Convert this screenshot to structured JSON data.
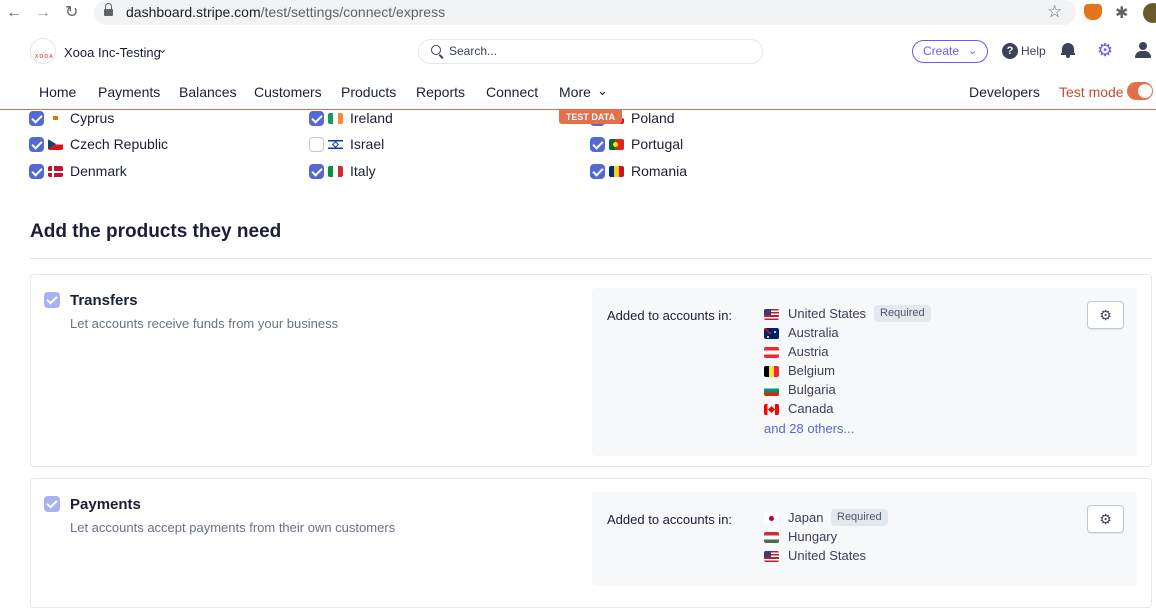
{
  "browser": {
    "url_domain": "dashboard.stripe.com",
    "url_path": "/test/settings/connect/express"
  },
  "header": {
    "account_logo_text": "XOOA",
    "account_name": "Xooa Inc-Testing",
    "search_placeholder": "Search...",
    "create_label": "Create",
    "help_label": "Help"
  },
  "nav": {
    "items": [
      "Home",
      "Payments",
      "Balances",
      "Customers",
      "Products",
      "Reports",
      "Connect",
      "More"
    ],
    "developers": "Developers",
    "test_mode": "Test mode",
    "test_mode_on": true,
    "test_data_badge": "TEST DATA",
    "accent_color": "#e56f4a"
  },
  "countries": [
    {
      "name": "Cyprus",
      "checked": true
    },
    {
      "name": "Czech Republic",
      "checked": true
    },
    {
      "name": "Denmark",
      "checked": true
    },
    {
      "name": "Ireland",
      "checked": true
    },
    {
      "name": "Israel",
      "checked": false
    },
    {
      "name": "Italy",
      "checked": true
    },
    {
      "name": "Poland",
      "checked": true
    },
    {
      "name": "Portugal",
      "checked": true
    },
    {
      "name": "Romania",
      "checked": true
    }
  ],
  "section_title": "Add the products they need",
  "products": [
    {
      "title": "Transfers",
      "description": "Let accounts receive funds from your business",
      "checked": true,
      "added_label": "Added to accounts in:",
      "countries": [
        "United States",
        "Australia",
        "Austria",
        "Belgium",
        "Bulgaria",
        "Canada"
      ],
      "required_badge": "Required",
      "others_link": "and 28 others..."
    },
    {
      "title": "Payments",
      "description": "Let accounts accept payments from their own customers",
      "checked": true,
      "added_label": "Added to accounts in:",
      "countries": [
        "Japan",
        "Hungary",
        "United States"
      ],
      "required_badge": "Required"
    }
  ]
}
